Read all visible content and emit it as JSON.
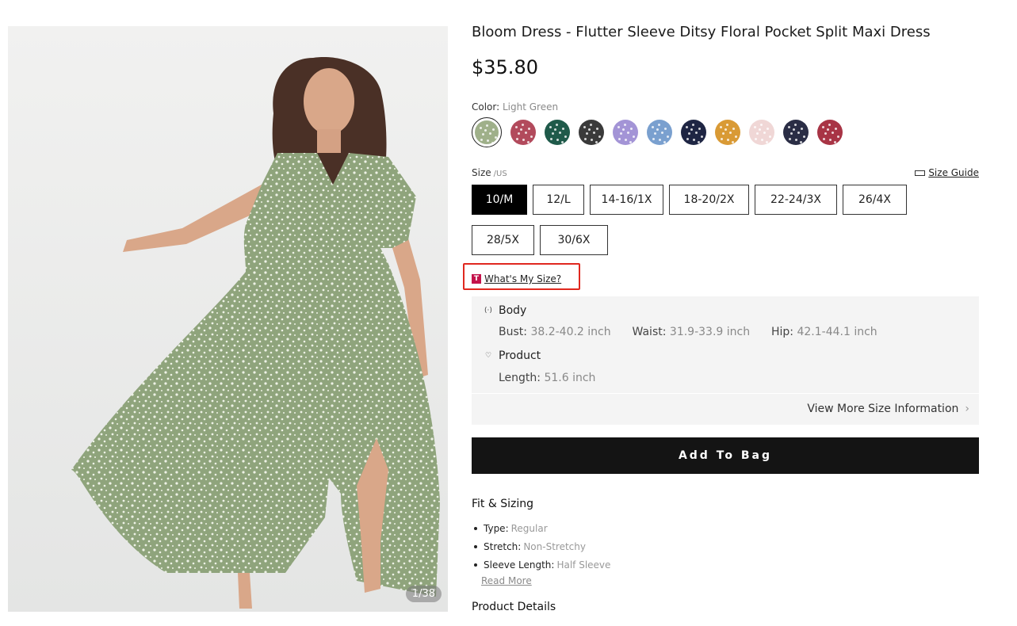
{
  "product": {
    "title": "Bloom Dress - Flutter Sleeve Ditsy Floral Pocket Split Maxi Dress",
    "price": "$35.80",
    "image_counter": "1/38"
  },
  "color": {
    "label": "Color:",
    "selected": "Light Green",
    "swatches": [
      {
        "name": "light-green",
        "color": "#9fb08a"
      },
      {
        "name": "rose-floral",
        "color": "#b24a5c"
      },
      {
        "name": "teal-floral",
        "color": "#1f5a4a"
      },
      {
        "name": "black-floral",
        "color": "#3a3a3a"
      },
      {
        "name": "lilac-floral",
        "color": "#a394d6"
      },
      {
        "name": "blue-floral",
        "color": "#7aa0cf"
      },
      {
        "name": "navy-floral",
        "color": "#1e2543"
      },
      {
        "name": "mustard-floral",
        "color": "#d99a35"
      },
      {
        "name": "blush-floral",
        "color": "#f0d7d6"
      },
      {
        "name": "dark-navy-floral",
        "color": "#2a2d45"
      },
      {
        "name": "burgundy-floral",
        "color": "#a83445"
      }
    ]
  },
  "size": {
    "label": "Size",
    "unit": "/US",
    "guide": "Size Guide",
    "options": [
      "10/M",
      "12/L",
      "14-16/1X",
      "18-20/2X",
      "22-24/3X",
      "26/4X",
      "28/5X",
      "30/6X"
    ],
    "selected": "10/M"
  },
  "whats_my_size": {
    "badge": "T",
    "label": "What's My Size?"
  },
  "size_info": {
    "body_label": "Body",
    "bust_label": "Bust:",
    "bust": "38.2-40.2 inch",
    "waist_label": "Waist:",
    "waist": "31.9-33.9 inch",
    "hip_label": "Hip:",
    "hip": "42.1-44.1 inch",
    "product_label": "Product",
    "length_label": "Length:",
    "length": "51.6 inch",
    "more": "View More Size Information"
  },
  "add_to_bag": "Add To Bag",
  "fit": {
    "title": "Fit & Sizing",
    "items": [
      {
        "label": "Type:",
        "value": "Regular"
      },
      {
        "label": "Stretch:",
        "value": "Non-Stretchy"
      },
      {
        "label": "Sleeve Length:",
        "value": "Half Sleeve"
      }
    ],
    "read_more": "Read More"
  },
  "details": {
    "title": "Product Details"
  }
}
